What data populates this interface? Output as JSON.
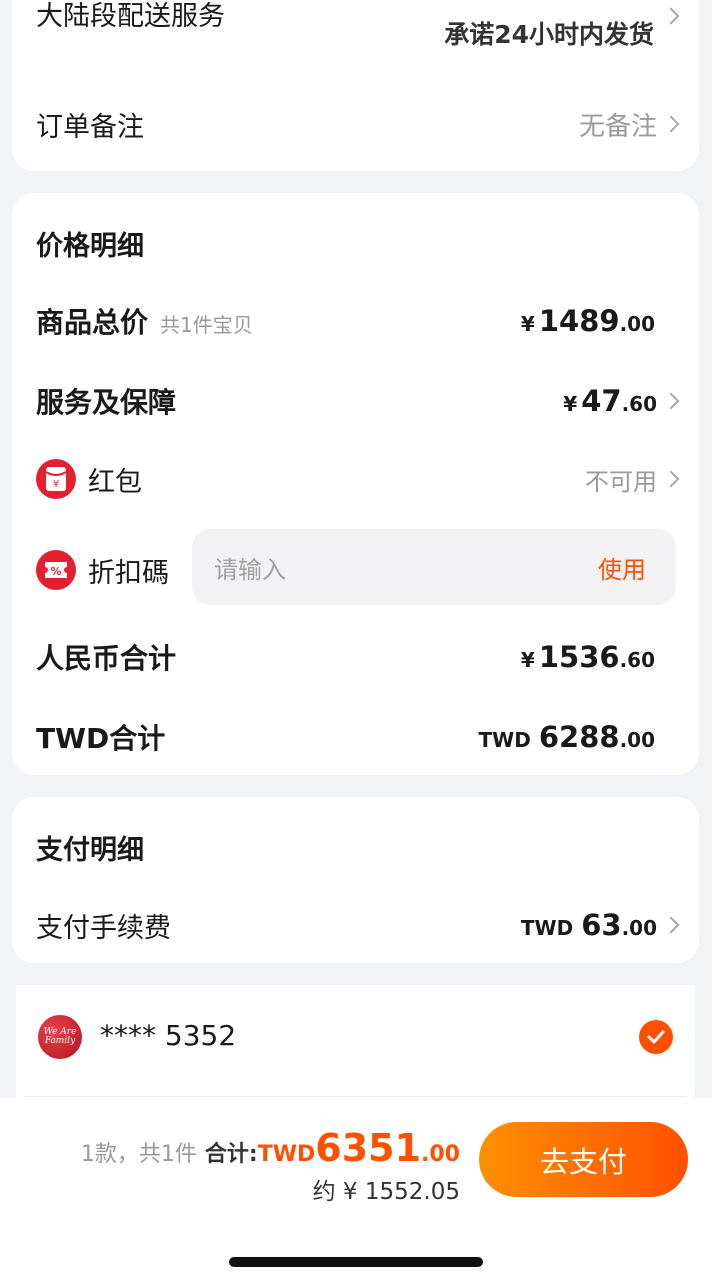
{
  "top_card": {
    "shipping_label": "大陆段配送服务",
    "shipping_value": "承诺24小时内发货",
    "remark_label": "订单备注",
    "remark_value": "无备注"
  },
  "price_detail": {
    "title": "价格明细",
    "goods_total_label": "商品总价",
    "goods_count_text": "共1件宝贝",
    "goods_total": {
      "currency": "¥",
      "int": "1489",
      "dec": ".00"
    },
    "service_label": "服务及保障",
    "service": {
      "currency": "¥",
      "int": "47",
      "dec": ".60"
    },
    "redpack_label": "红包",
    "redpack_value": "不可用",
    "redpack_icon_text": "¥",
    "coupon_label": "折扣碼",
    "coupon_icon_text": "%",
    "coupon_placeholder": "请输入",
    "coupon_apply": "使用",
    "rmb_total_label": "人民币合计",
    "rmb_total": {
      "currency": "¥",
      "int": "1536",
      "dec": ".60"
    },
    "twd_total_label": "TWD合计",
    "twd_total": {
      "currency": "TWD",
      "int": "6288",
      "dec": ".00"
    }
  },
  "payment_detail": {
    "title": "支付明细",
    "fee_label": "支付手续费",
    "fee": {
      "currency": "TWD",
      "int": "63",
      "dec": ".00"
    }
  },
  "card_method": {
    "logo_text": "We Are Family",
    "card_number": "**** 5352"
  },
  "bottom_bar": {
    "summary": "1款，共1件",
    "total_label": "合计:",
    "total_currency": "TWD",
    "total_int": "6351",
    "total_dec": ".00",
    "approx": "约 ¥ 1552.05",
    "pay_button": "去支付"
  },
  "colors": {
    "accent": "#ff5000",
    "button_gradient_start": "#ff9000",
    "button_gradient_end": "#ff5000",
    "icon_red": "#e4202e"
  }
}
